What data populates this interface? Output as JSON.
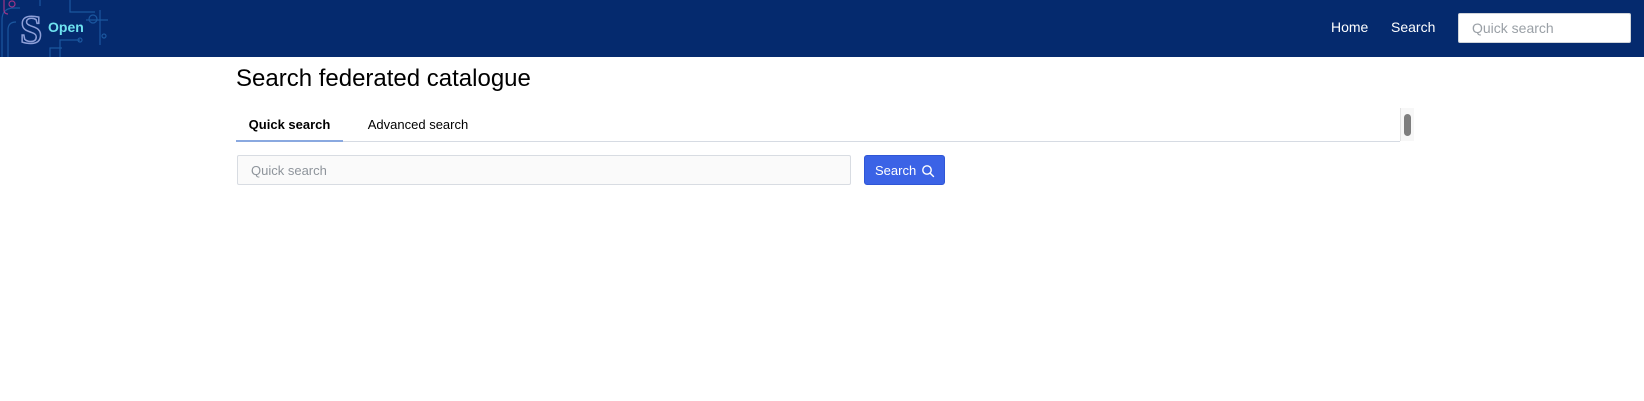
{
  "header": {
    "logo_text": "Open",
    "nav": [
      {
        "label": "Home"
      },
      {
        "label": "Search"
      }
    ],
    "search_placeholder": "Quick search",
    "background_color": "#052a6e"
  },
  "page": {
    "title": "Search federated catalogue"
  },
  "tabs": [
    {
      "label": "Quick search",
      "active": true
    },
    {
      "label": "Advanced search",
      "active": false
    }
  ],
  "search": {
    "placeholder": "Quick search",
    "value": "",
    "button_label": "Search",
    "button_icon": "search-icon",
    "button_color": "#3b63e6"
  }
}
